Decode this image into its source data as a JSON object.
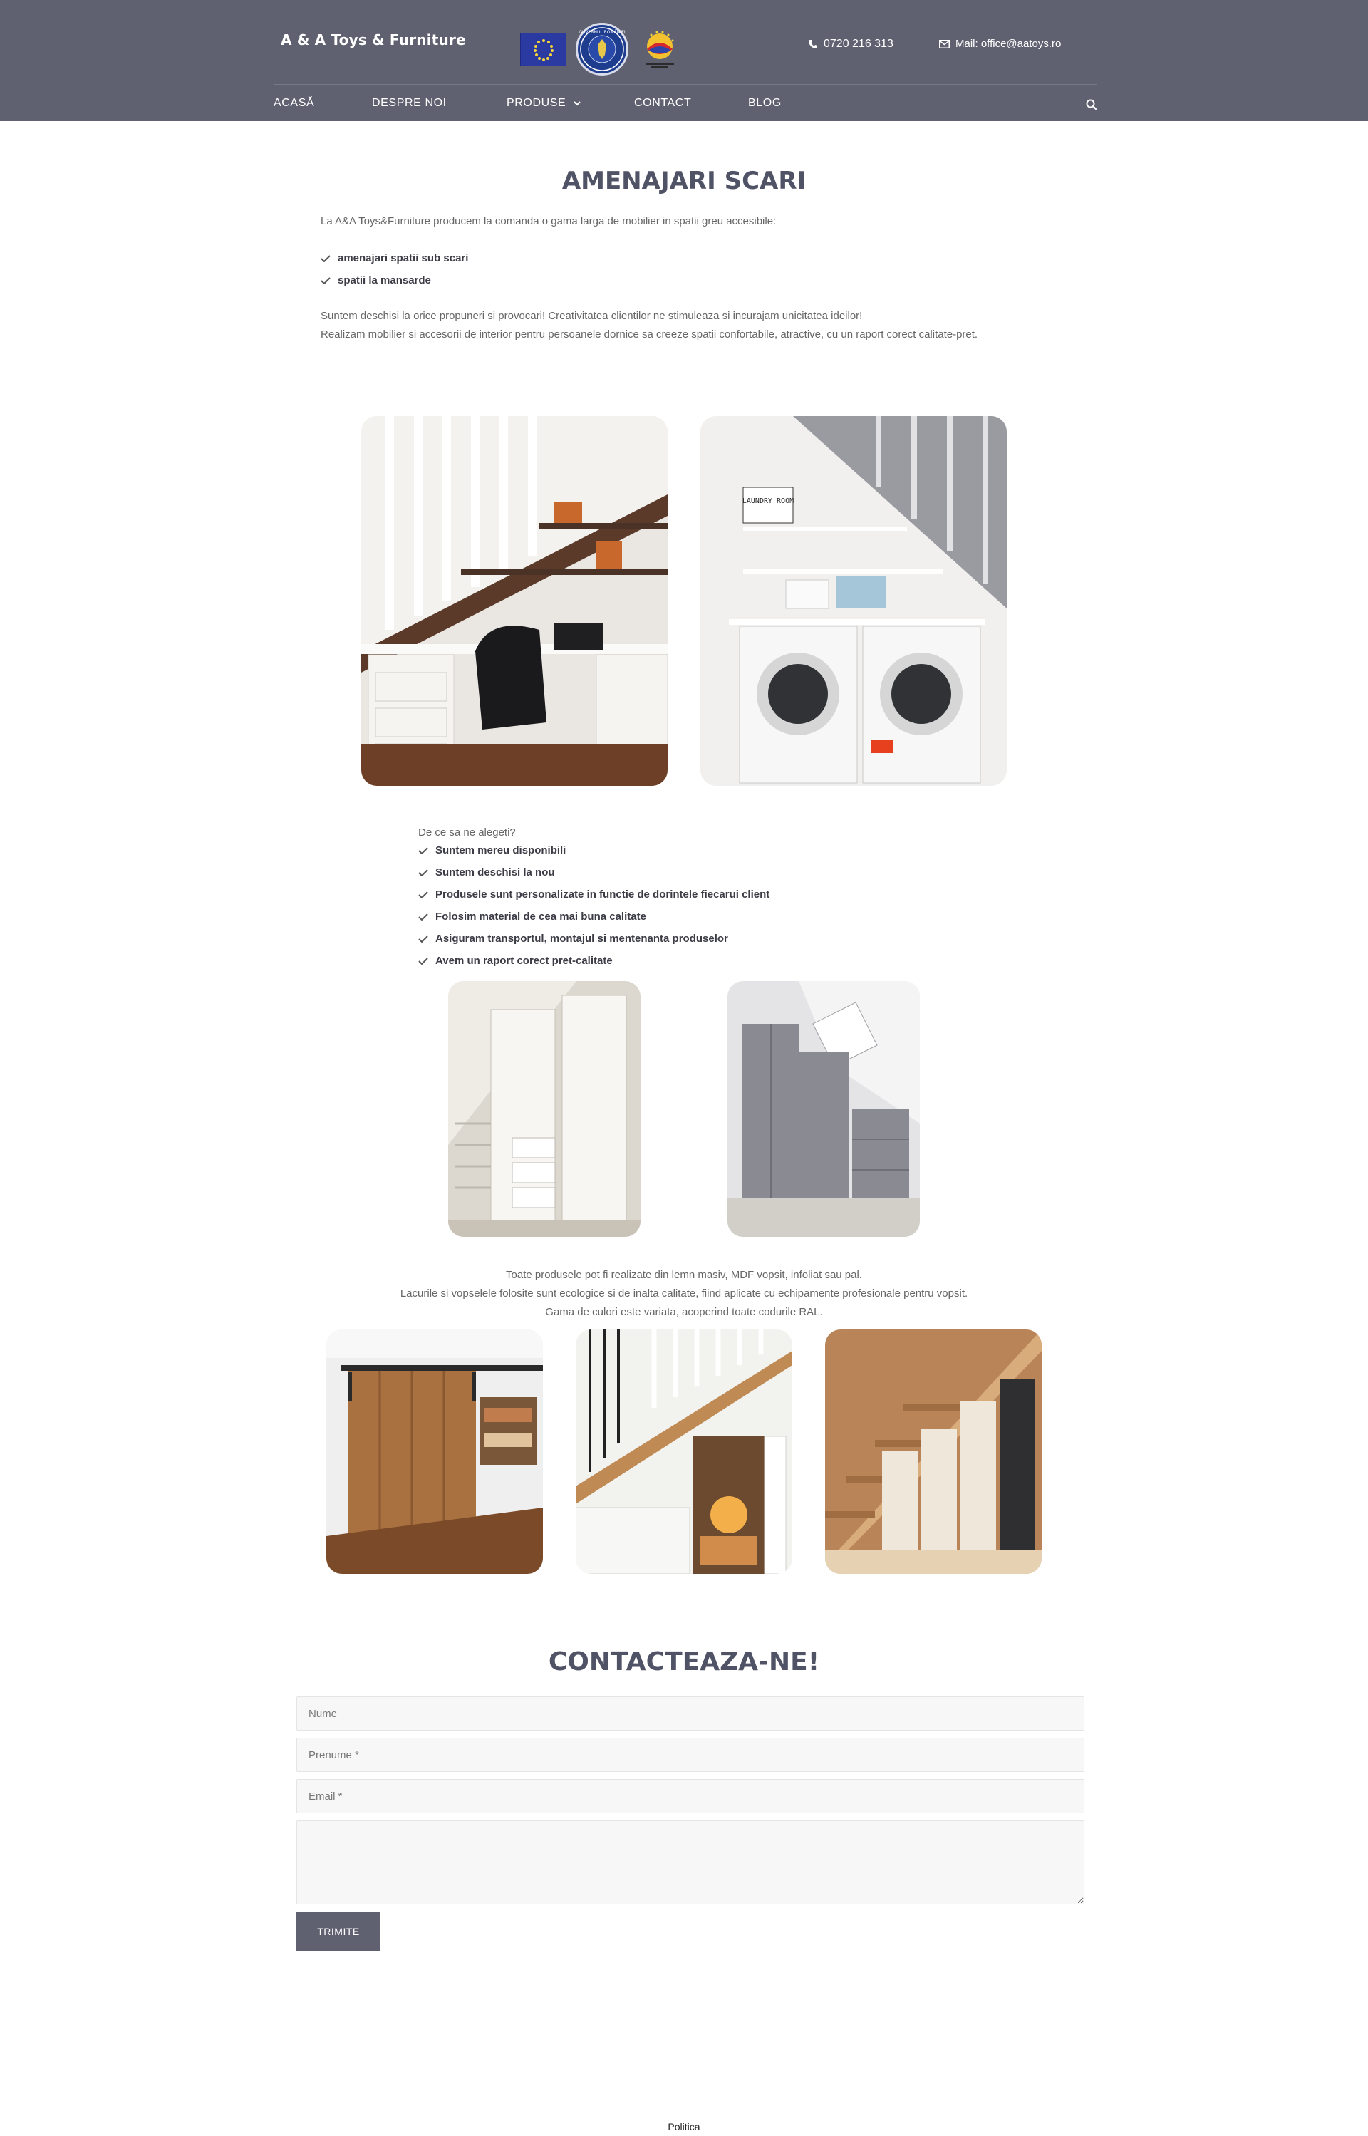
{
  "header": {
    "brand": "A & A Toys & Furniture",
    "phone": "0720 216 313",
    "mail": "Mail: office@aatoys.ro",
    "logo_gov_text": "GUVERNUL ROMÂNIEI",
    "nav": [
      {
        "label": "ACASĂ"
      },
      {
        "label": "DESPRE NOI"
      },
      {
        "label": "PRODUSE"
      },
      {
        "label": "CONTACT"
      },
      {
        "label": "BLOG"
      }
    ]
  },
  "page": {
    "title": "AMENAJARI SCARI",
    "intro": "La A&A Toys&Furniture producem la comanda o gama larga de mobilier in spatii greu accesibile:",
    "spaces": [
      "amenajari spatii sub scari",
      "spatii la mansarde"
    ],
    "paragraph_1": "Suntem deschisi la orice propuneri si provocari! Creativitatea clientilor ne stimuleaza si incurajam unicitatea ideilor!",
    "paragraph_2": "Realizam mobilier si accesorii de interior pentru persoanele dornice sa creeze spatii confortabile, atractive, cu un raport corect calitate-pret.",
    "photo_labels": {
      "laundry_sign": "LAUNDRY ROOM"
    },
    "why_label": "De ce sa ne alegeti?",
    "reasons": [
      "Suntem mereu disponibili",
      "Suntem deschisi la nou",
      "Produsele sunt personalizate in functie de dorintele fiecarui client",
      "Folosim material de cea mai buna calitate",
      "Asiguram transportul, montajul si mentenanta produselor",
      "Avem un raport corect pret-calitate"
    ],
    "materials_1": "Toate produsele pot fi realizate din lemn masiv, MDF vopsit, infoliat sau pal.",
    "materials_2": "Lacurile si vopselele folosite sunt ecologice si de inalta calitate, fiind aplicate cu echipamente profesionale pentru vopsit.",
    "materials_3": "Gama de culori este variata, acoperind toate codurile RAL."
  },
  "contact": {
    "title": "CONTACTEAZA-NE!",
    "name_placeholder": "Nume",
    "firstname_placeholder": "Prenume *",
    "email_placeholder": "Email *",
    "message_placeholder": "",
    "submit_label": "TRIMITE"
  },
  "footer": {
    "policy_link": "Politica"
  },
  "colors": {
    "header_bg": "#5f6170",
    "title": "#505366",
    "button_bg": "#5f6170"
  }
}
